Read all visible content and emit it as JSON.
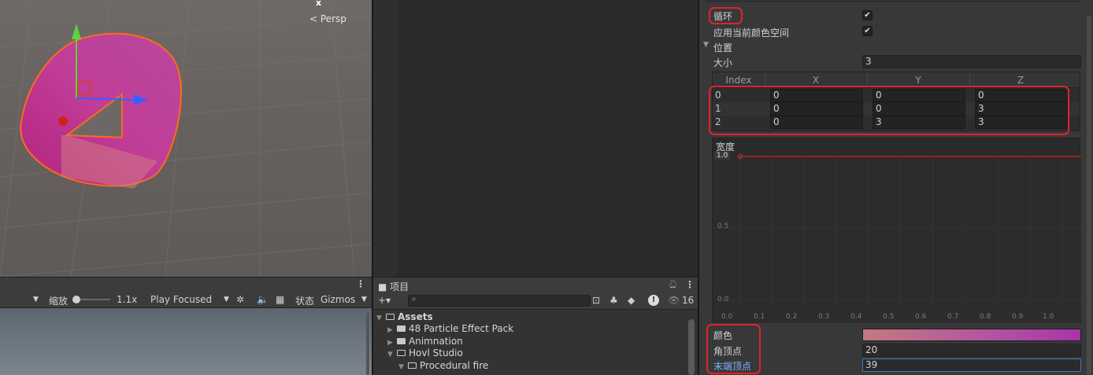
{
  "scene": {
    "projection_label": "Persp",
    "axis_label": "x"
  },
  "game_toolbar": {
    "scale_label": "缩放",
    "scale_value": "1.1x",
    "play_mode": "Play Focused",
    "stats_label": "状态",
    "gizmos_label": "Gizmos"
  },
  "project": {
    "tab_label": "项目",
    "badge_count": "16",
    "tree": [
      {
        "label": "Assets",
        "expanded": true,
        "depth": 0
      },
      {
        "label": "48 Particle Effect Pack",
        "expanded": false,
        "depth": 1
      },
      {
        "label": "Animnation",
        "expanded": false,
        "depth": 1
      },
      {
        "label": "Hovl Studio",
        "expanded": true,
        "depth": 1
      },
      {
        "label": "Procedural fire",
        "expanded": true,
        "depth": 2
      }
    ]
  },
  "inspector": {
    "loop_label": "循环",
    "loop_checked": true,
    "color_space_label": "应用当前颜色空间",
    "color_space_checked": true,
    "positions_label": "位置",
    "size_label": "大小",
    "size_value": "3",
    "table": {
      "headers": [
        "Index",
        "X",
        "Y",
        "Z"
      ],
      "rows": [
        {
          "index": "0",
          "x": "0",
          "y": "0",
          "z": "0"
        },
        {
          "index": "1",
          "x": "0",
          "y": "0",
          "z": "3"
        },
        {
          "index": "2",
          "x": "0",
          "y": "3",
          "z": "3"
        }
      ]
    },
    "width_label": "宽度",
    "width_curve": {
      "value_label": "1.0",
      "y_ticks": [
        "0.5",
        "0.0"
      ],
      "x_ticks": [
        "0.0",
        "0.1",
        "0.2",
        "0.3",
        "0.4",
        "0.5",
        "0.6",
        "0.7",
        "0.8",
        "0.9",
        "1.0"
      ]
    },
    "color_label": "颜色",
    "corner_vertices_label": "角顶点",
    "corner_vertices_value": "20",
    "end_cap_vertices_label": "末端顶点",
    "end_cap_vertices_value": "39",
    "colors": {
      "highlight_red": "#e0242a",
      "gradient_start": "#c27a80",
      "gradient_end": "#a834a8",
      "active_label": "#7fb3ff"
    }
  }
}
